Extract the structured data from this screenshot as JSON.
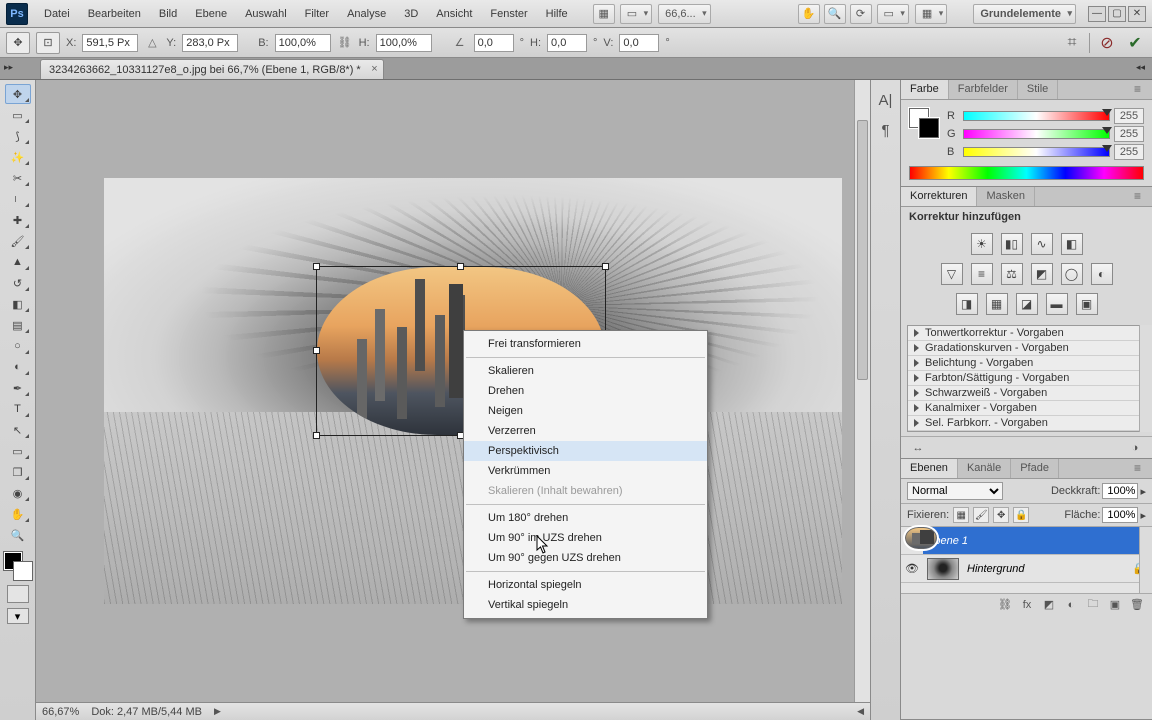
{
  "menu": {
    "items": [
      "Datei",
      "Bearbeiten",
      "Bild",
      "Ebene",
      "Auswahl",
      "Filter",
      "Analyse",
      "3D",
      "Ansicht",
      "Fenster",
      "Hilfe"
    ],
    "zoom_combo": "66,6...",
    "workspace": "Grundelemente"
  },
  "optbar": {
    "x_label": "X:",
    "x": "591,5 Px",
    "y_label": "Y:",
    "y": "283,0 Px",
    "w_label": "B:",
    "w": "100,0%",
    "h_label": "H:",
    "h": "100,0%",
    "angle": "0,0",
    "skew_h_label": "H:",
    "skew_h": "0,0",
    "skew_v_label": "V:",
    "skew_v": "0,0",
    "deg": "°"
  },
  "doc": {
    "title": "3234263662_10331127e8_o.jpg bei 66,7% (Ebene 1, RGB/8*) *"
  },
  "context_menu": {
    "items": [
      {
        "label": "Frei transformieren"
      },
      {
        "sep": true
      },
      {
        "label": "Skalieren"
      },
      {
        "label": "Drehen"
      },
      {
        "label": "Neigen"
      },
      {
        "label": "Verzerren"
      },
      {
        "label": "Perspektivisch",
        "hl": true
      },
      {
        "label": "Verkrümmen"
      },
      {
        "label": "Skalieren (Inhalt bewahren)",
        "disabled": true
      },
      {
        "sep": true
      },
      {
        "label": "Um 180° drehen"
      },
      {
        "label": "Um 90° im UZS drehen"
      },
      {
        "label": "Um 90° gegen UZS drehen"
      },
      {
        "sep": true
      },
      {
        "label": "Horizontal spiegeln"
      },
      {
        "label": "Vertikal spiegeln"
      }
    ]
  },
  "color_panel": {
    "tabs": [
      "Farbe",
      "Farbfelder",
      "Stile"
    ],
    "r_label": "R",
    "g_label": "G",
    "b_label": "B",
    "r": "255",
    "g": "255",
    "b": "255"
  },
  "korrekturen": {
    "tabs": [
      "Korrekturen",
      "Masken"
    ],
    "heading": "Korrektur hinzufügen",
    "presets": [
      "Tonwertkorrektur - Vorgaben",
      "Gradationskurven - Vorgaben",
      "Belichtung - Vorgaben",
      "Farbton/Sättigung - Vorgaben",
      "Schwarzweiß - Vorgaben",
      "Kanalmixer - Vorgaben",
      "Sel. Farbkorr. - Vorgaben"
    ]
  },
  "layers_panel": {
    "tabs": [
      "Ebenen",
      "Kanäle",
      "Pfade"
    ],
    "blend": "Normal",
    "opacity_label": "Deckkraft:",
    "opacity": "100%",
    "lock_label": "Fixieren:",
    "fill_label": "Fläche:",
    "fill": "100%",
    "layers": [
      {
        "name": "Ebene 1",
        "selected": true
      },
      {
        "name": "Hintergrund",
        "locked": true
      }
    ]
  },
  "status": {
    "zoom": "66,67%",
    "doc": "Dok: 2,47 MB/5,44 MB"
  }
}
